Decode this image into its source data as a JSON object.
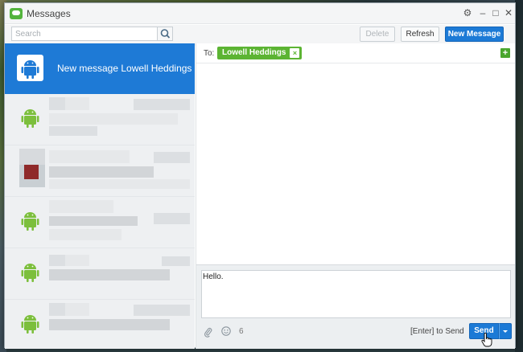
{
  "window": {
    "title": "Messages"
  },
  "window_controls": {
    "settings": "⚙",
    "minimize": "–",
    "maximize": "□",
    "close": "✕"
  },
  "toolbar": {
    "search_placeholder": "Search",
    "delete_label": "Delete",
    "refresh_label": "Refresh",
    "new_message_label": "New Message"
  },
  "sidebar": {
    "new_message_item": "New message Lowell Heddings"
  },
  "compose_header": {
    "to_label": "To:",
    "recipient": "Lowell Heddings",
    "remove_symbol": "×",
    "add_symbol": "+"
  },
  "composer": {
    "message_text": "Hello.",
    "char_count": "6",
    "enter_hint": "[Enter] to Send",
    "send_label": "Send"
  },
  "colors": {
    "accent": "#1c7ad6",
    "android_green": "#7cbf3c",
    "chip_green": "#5cb433"
  },
  "icons": [
    "messages-app-icon",
    "gear-icon",
    "search-icon",
    "android-icon",
    "plus-icon",
    "paperclip-icon",
    "smiley-icon",
    "chevron-down-icon",
    "hand-cursor-icon"
  ]
}
